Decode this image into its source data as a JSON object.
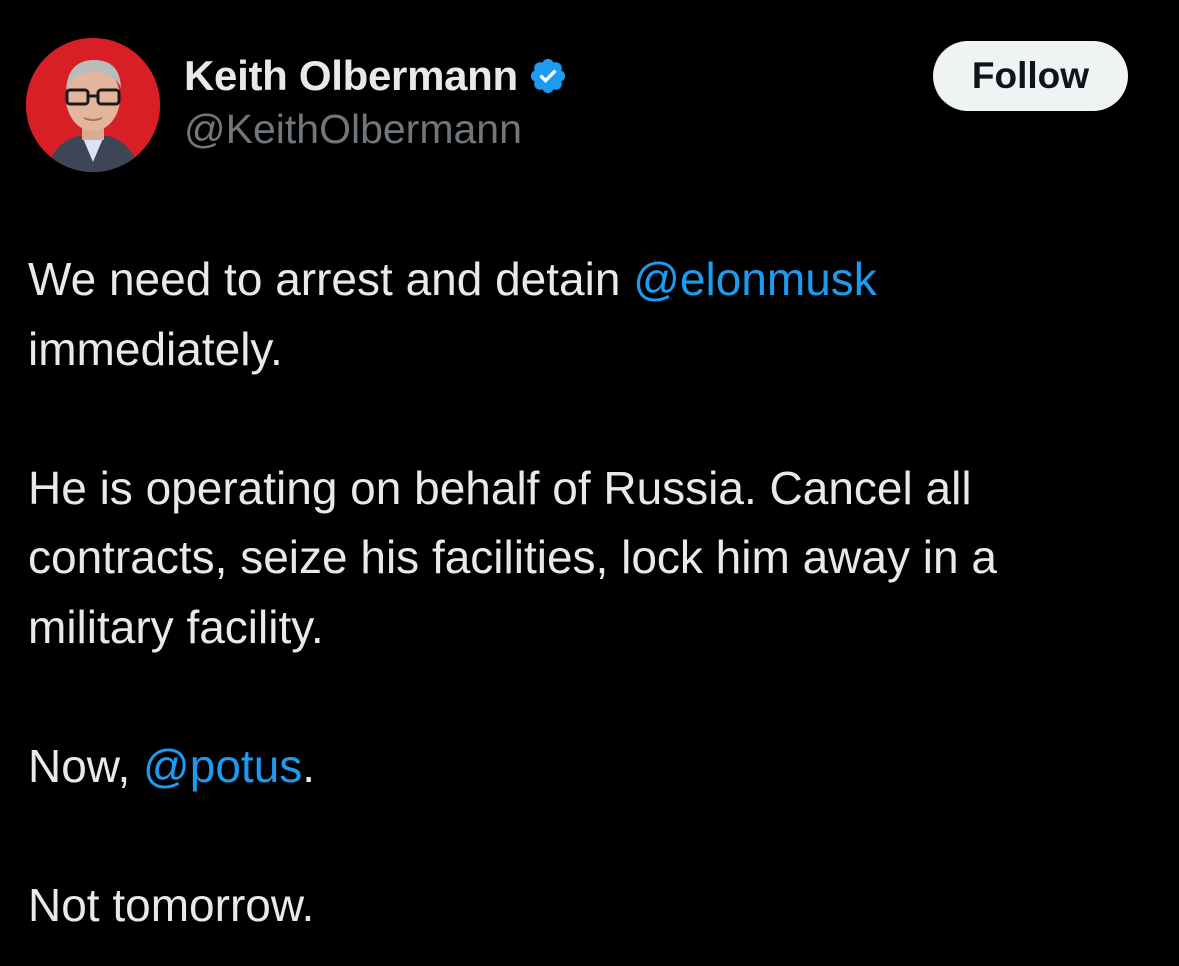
{
  "colors": {
    "background": "#000000",
    "text": "#e7e9ea",
    "secondary_text": "#71767b",
    "mention": "#1d9bf0",
    "verified_badge": "#1d9bf0",
    "follow_button_bg": "#eff3f4",
    "avatar_bg": "#d81f26"
  },
  "author": {
    "display_name": "Keith Olbermann",
    "handle": "@KeithOlbermann",
    "verified_icon": "verified-badge-icon",
    "avatar_icon": "profile-photo"
  },
  "follow_button": {
    "label": "Follow"
  },
  "tweet": {
    "paragraphs": [
      {
        "line1_text": "We need to arrest and detain ",
        "line1_mention": "@elonmusk",
        "line2_text": "immediately."
      },
      {
        "line1_text": "He is operating on behalf of Russia. Cancel all",
        "line2_text": "contracts, seize his facilities, lock him away in a",
        "line3_text": "military facility."
      },
      {
        "text_before": "Now, ",
        "mention": "@potus",
        "text_after": "."
      },
      {
        "text": "Not tomorrow."
      }
    ]
  }
}
